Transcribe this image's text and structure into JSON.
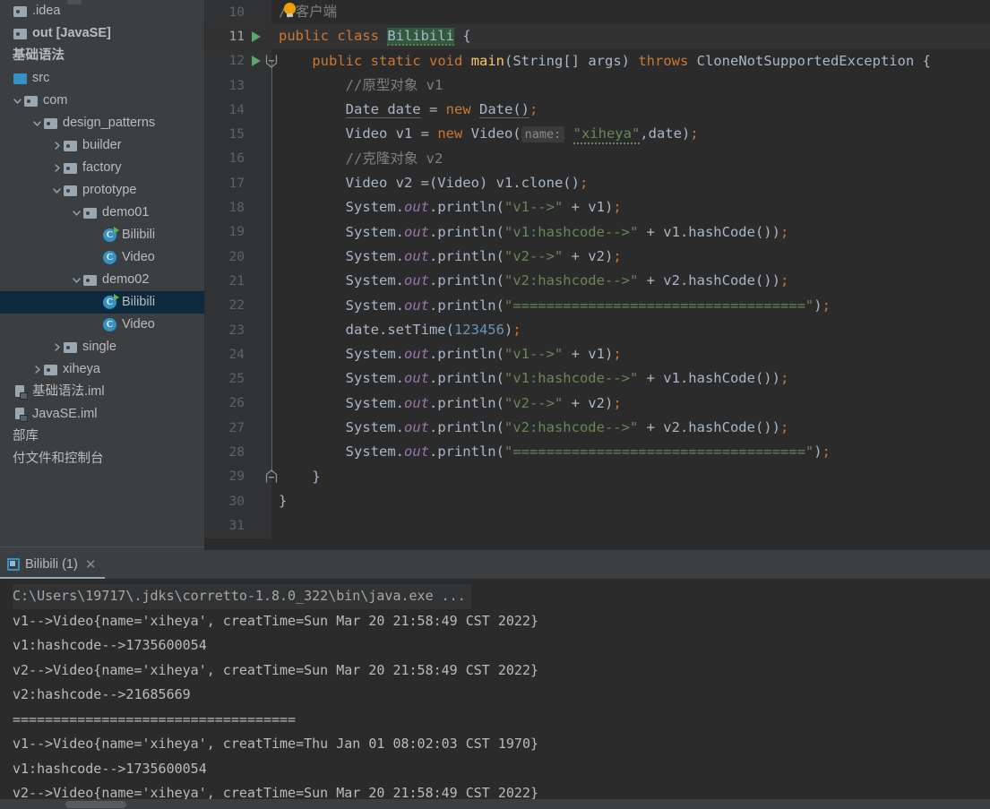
{
  "theme": {
    "editor_bg": "#2B2B2B",
    "gutter_bg": "#313335",
    "panel_bg": "#3C3F41",
    "selection_bg": "#0D293E",
    "accent_blue": "#3592C4",
    "run_green": "#59A869",
    "text": "#A9B7C6",
    "keyword": "#CC7832",
    "string": "#6A8759",
    "number": "#6897BB",
    "comment": "#808080",
    "static_field": "#9876AA",
    "method": "#FFC66D"
  },
  "sidebar": {
    "name": "project-tree",
    "items": [
      {
        "label": ".idea",
        "icon": "folder-icon",
        "depth": 0,
        "twisty": "none",
        "selected": false,
        "bold": false
      },
      {
        "label": "out [JavaSE]",
        "icon": "folder-icon",
        "depth": 0,
        "twisty": "none",
        "selected": false,
        "bold": true
      },
      {
        "label": "基础语法",
        "icon": "module-icon",
        "depth": 0,
        "twisty": "none",
        "selected": false,
        "bold": true
      },
      {
        "label": "src",
        "icon": "folder-blue-icon",
        "depth": 0,
        "twisty": "none",
        "selected": false,
        "bold": false
      },
      {
        "label": "com",
        "icon": "folder-icon",
        "depth": 1,
        "twisty": "expanded",
        "selected": false,
        "bold": false
      },
      {
        "label": "design_patterns",
        "icon": "folder-icon",
        "depth": 2,
        "twisty": "expanded",
        "selected": false,
        "bold": false
      },
      {
        "label": "builder",
        "icon": "folder-icon",
        "depth": 3,
        "twisty": "collapsed",
        "selected": false,
        "bold": false
      },
      {
        "label": "factory",
        "icon": "folder-icon",
        "depth": 3,
        "twisty": "collapsed",
        "selected": false,
        "bold": false
      },
      {
        "label": "prototype",
        "icon": "folder-icon",
        "depth": 3,
        "twisty": "expanded",
        "selected": false,
        "bold": false
      },
      {
        "label": "demo01",
        "icon": "folder-icon",
        "depth": 4,
        "twisty": "expanded",
        "selected": false,
        "bold": false
      },
      {
        "label": "Bilibili",
        "icon": "java-class-runnable-icon",
        "depth": 5,
        "twisty": "none",
        "selected": false,
        "bold": false
      },
      {
        "label": "Video",
        "icon": "java-class-icon",
        "depth": 5,
        "twisty": "none",
        "selected": false,
        "bold": false
      },
      {
        "label": "demo02",
        "icon": "folder-icon",
        "depth": 4,
        "twisty": "expanded",
        "selected": false,
        "bold": false
      },
      {
        "label": "Bilibili",
        "icon": "java-class-runnable-icon",
        "depth": 5,
        "twisty": "none",
        "selected": true,
        "bold": false
      },
      {
        "label": "Video",
        "icon": "java-class-icon",
        "depth": 5,
        "twisty": "none",
        "selected": false,
        "bold": false
      },
      {
        "label": "single",
        "icon": "folder-icon",
        "depth": 3,
        "twisty": "collapsed",
        "selected": false,
        "bold": false
      },
      {
        "label": "xiheya",
        "icon": "folder-icon",
        "depth": 2,
        "twisty": "collapsed",
        "selected": false,
        "bold": false
      },
      {
        "label": "基础语法.iml",
        "icon": "iml-file-icon",
        "depth": 0,
        "twisty": "none",
        "selected": false,
        "bold": false
      },
      {
        "label": "JavaSE.iml",
        "icon": "iml-file-icon",
        "depth": 0,
        "twisty": "none",
        "selected": false,
        "bold": false
      },
      {
        "label": "部库",
        "icon": "none",
        "depth": 0,
        "twisty": "none",
        "selected": false,
        "bold": false
      },
      {
        "label": "付文件和控制台",
        "icon": "none",
        "depth": 0,
        "twisty": "none",
        "selected": false,
        "bold": false
      }
    ]
  },
  "editor": {
    "name": "code-editor",
    "first_visible_line": 10,
    "lines": [
      {
        "num": "10",
        "runnable": false,
        "fold": "none",
        "active": false,
        "tokens": [
          {
            "t": "//客户端",
            "c": "cmt",
            "indent": 0
          }
        ]
      },
      {
        "num": "11",
        "runnable": true,
        "fold": "none",
        "active": true,
        "tokens": [
          {
            "t": "public",
            "c": "kw"
          },
          {
            "t": " "
          },
          {
            "t": "class",
            "c": "kw"
          },
          {
            "t": " "
          },
          {
            "t": "Bilibili",
            "c": "hl-class"
          },
          {
            "t": " {"
          }
        ]
      },
      {
        "num": "12",
        "runnable": true,
        "fold": "start",
        "active": false,
        "tokens": [
          {
            "t": "    "
          },
          {
            "t": "public",
            "c": "kw"
          },
          {
            "t": " "
          },
          {
            "t": "static",
            "c": "kw"
          },
          {
            "t": " "
          },
          {
            "t": "void",
            "c": "kw"
          },
          {
            "t": " "
          },
          {
            "t": "main",
            "c": "mth"
          },
          {
            "t": "(String[] args) "
          },
          {
            "t": "throws",
            "c": "kw"
          },
          {
            "t": " CloneNotSupportedException {"
          }
        ]
      },
      {
        "num": "13",
        "runnable": false,
        "fold": "none",
        "active": false,
        "tokens": [
          {
            "t": "        //原型对象 v1",
            "c": "cmt"
          }
        ]
      },
      {
        "num": "14",
        "runnable": false,
        "fold": "none",
        "active": false,
        "tokens": [
          {
            "t": "        "
          },
          {
            "t": "Date date",
            "c": "decl"
          },
          {
            "t": " = "
          },
          {
            "t": "new",
            "c": "kw"
          },
          {
            "t": " "
          },
          {
            "t": "Date()",
            "c": "decl"
          },
          {
            "t": ";",
            "c": "kw"
          }
        ]
      },
      {
        "num": "15",
        "runnable": false,
        "fold": "none",
        "active": false,
        "tokens": [
          {
            "t": "        Video v1 = "
          },
          {
            "t": "new",
            "c": "kw"
          },
          {
            "t": " Video("
          },
          {
            "t": "name:",
            "c": "hint"
          },
          {
            "t": "\"xiheya\"",
            "c": "str-squig"
          },
          {
            "t": ",date)"
          },
          {
            "t": ";",
            "c": "kw"
          }
        ]
      },
      {
        "num": "16",
        "runnable": false,
        "fold": "none",
        "active": false,
        "tokens": [
          {
            "t": "        //克隆对象 v2",
            "c": "cmt"
          }
        ]
      },
      {
        "num": "17",
        "runnable": false,
        "fold": "none",
        "active": false,
        "tokens": [
          {
            "t": "        Video v2 =(Video) v1.clone()"
          },
          {
            "t": ";",
            "c": "kw"
          }
        ]
      },
      {
        "num": "18",
        "runnable": false,
        "fold": "none",
        "active": false,
        "tokens": [
          {
            "t": "        System."
          },
          {
            "t": "out",
            "c": "sfl"
          },
          {
            "t": ".println("
          },
          {
            "t": "\"v1-->\"",
            "c": "str"
          },
          {
            "t": " + v1)"
          },
          {
            "t": ";",
            "c": "kw"
          }
        ]
      },
      {
        "num": "19",
        "runnable": false,
        "fold": "none",
        "active": false,
        "tokens": [
          {
            "t": "        System."
          },
          {
            "t": "out",
            "c": "sfl"
          },
          {
            "t": ".println("
          },
          {
            "t": "\"v1:hashcode-->\"",
            "c": "str"
          },
          {
            "t": " + v1.hashCode())"
          },
          {
            "t": ";",
            "c": "kw"
          }
        ]
      },
      {
        "num": "20",
        "runnable": false,
        "fold": "none",
        "active": false,
        "tokens": [
          {
            "t": "        System."
          },
          {
            "t": "out",
            "c": "sfl"
          },
          {
            "t": ".println("
          },
          {
            "t": "\"v2-->\"",
            "c": "str"
          },
          {
            "t": " + v2)"
          },
          {
            "t": ";",
            "c": "kw"
          }
        ]
      },
      {
        "num": "21",
        "runnable": false,
        "fold": "none",
        "active": false,
        "tokens": [
          {
            "t": "        System."
          },
          {
            "t": "out",
            "c": "sfl"
          },
          {
            "t": ".println("
          },
          {
            "t": "\"v2:hashcode-->\"",
            "c": "str"
          },
          {
            "t": " + v2.hashCode())"
          },
          {
            "t": ";",
            "c": "kw"
          }
        ]
      },
      {
        "num": "22",
        "runnable": false,
        "fold": "none",
        "active": false,
        "tokens": [
          {
            "t": "        System."
          },
          {
            "t": "out",
            "c": "sfl"
          },
          {
            "t": ".println("
          },
          {
            "t": "\"===================================\"",
            "c": "str"
          },
          {
            "t": ")"
          },
          {
            "t": ";",
            "c": "kw"
          }
        ]
      },
      {
        "num": "23",
        "runnable": false,
        "fold": "none",
        "active": false,
        "tokens": [
          {
            "t": "        date.setTime("
          },
          {
            "t": "123456",
            "c": "num"
          },
          {
            "t": ")"
          },
          {
            "t": ";",
            "c": "kw"
          }
        ]
      },
      {
        "num": "24",
        "runnable": false,
        "fold": "none",
        "active": false,
        "tokens": [
          {
            "t": "        System."
          },
          {
            "t": "out",
            "c": "sfl"
          },
          {
            "t": ".println("
          },
          {
            "t": "\"v1-->\"",
            "c": "str"
          },
          {
            "t": " + v1)"
          },
          {
            "t": ";",
            "c": "kw"
          }
        ]
      },
      {
        "num": "25",
        "runnable": false,
        "fold": "none",
        "active": false,
        "tokens": [
          {
            "t": "        System."
          },
          {
            "t": "out",
            "c": "sfl"
          },
          {
            "t": ".println("
          },
          {
            "t": "\"v1:hashcode-->\"",
            "c": "str"
          },
          {
            "t": " + v1.hashCode())"
          },
          {
            "t": ";",
            "c": "kw"
          }
        ]
      },
      {
        "num": "26",
        "runnable": false,
        "fold": "none",
        "active": false,
        "tokens": [
          {
            "t": "        System."
          },
          {
            "t": "out",
            "c": "sfl"
          },
          {
            "t": ".println("
          },
          {
            "t": "\"v2-->\"",
            "c": "str"
          },
          {
            "t": " + v2)"
          },
          {
            "t": ";",
            "c": "kw"
          }
        ]
      },
      {
        "num": "27",
        "runnable": false,
        "fold": "none",
        "active": false,
        "tokens": [
          {
            "t": "        System."
          },
          {
            "t": "out",
            "c": "sfl"
          },
          {
            "t": ".println("
          },
          {
            "t": "\"v2:hashcode-->\"",
            "c": "str"
          },
          {
            "t": " + v2.hashCode())"
          },
          {
            "t": ";",
            "c": "kw"
          }
        ]
      },
      {
        "num": "28",
        "runnable": false,
        "fold": "none",
        "active": false,
        "tokens": [
          {
            "t": "        System."
          },
          {
            "t": "out",
            "c": "sfl"
          },
          {
            "t": ".println("
          },
          {
            "t": "\"===================================\"",
            "c": "str"
          },
          {
            "t": ")"
          },
          {
            "t": ";",
            "c": "kw"
          }
        ]
      },
      {
        "num": "29",
        "runnable": false,
        "fold": "end",
        "active": false,
        "tokens": [
          {
            "t": "    }"
          }
        ]
      },
      {
        "num": "30",
        "runnable": false,
        "fold": "none",
        "active": false,
        "tokens": [
          {
            "t": "}"
          }
        ]
      },
      {
        "num": "31",
        "runnable": false,
        "fold": "none",
        "active": false,
        "tokens": [
          {
            "t": ""
          }
        ]
      }
    ]
  },
  "console": {
    "name": "run-tool-window",
    "tab": {
      "label": "Bilibili (1)",
      "icon": "run-config-icon",
      "close_icon": "close-icon"
    },
    "command": "C:\\Users\\19717\\.jdks\\corretto-1.8.0_322\\bin\\java.exe ...",
    "output": [
      "v1-->Video{name='xiheya', creatTime=Sun Mar 20 21:58:49 CST 2022}",
      "v1:hashcode-->1735600054",
      "v2-->Video{name='xiheya', creatTime=Sun Mar 20 21:58:49 CST 2022}",
      "v2:hashcode-->21685669",
      "===================================",
      "v1-->Video{name='xiheya', creatTime=Thu Jan 01 08:02:03 CST 1970}",
      "v1:hashcode-->1735600054",
      "v2-->Video{name='xiheya', creatTime=Sun Mar 20 21:58:49 CST 2022}"
    ]
  }
}
